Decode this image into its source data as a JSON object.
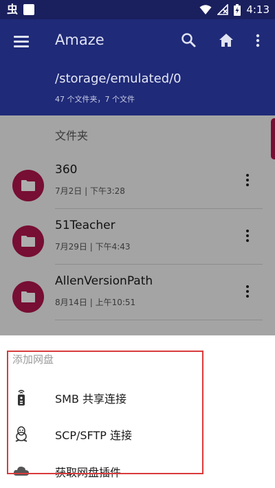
{
  "status_bar": {
    "app_indicator": "虫",
    "time": "4:13"
  },
  "app_bar": {
    "title": "Amaze",
    "path": "/storage/emulated/0",
    "summary": "47 个文件夹，7 个文件"
  },
  "list": {
    "section_header": "文件夹",
    "items": [
      {
        "name": "360",
        "date": "7月2日 | 下午3:28"
      },
      {
        "name": "51Teacher",
        "date": "7月29日 | 下午4:43"
      },
      {
        "name": "AllenVersionPath",
        "date": "8月14日 | 上午10:51"
      }
    ]
  },
  "sheet": {
    "title": "添加网盘",
    "items": [
      {
        "label": "SMB 共享连接",
        "icon": "remote-icon"
      },
      {
        "label": "SCP/SFTP 连接",
        "icon": "linux-penguin-icon"
      },
      {
        "label": "获取网盘插件",
        "icon": "cloud-icon"
      }
    ]
  },
  "colors": {
    "primary": "#1f2a78",
    "status_bar": "#1a1f5e",
    "accent": "#b0154c",
    "highlight_border": "#d93a3a"
  }
}
